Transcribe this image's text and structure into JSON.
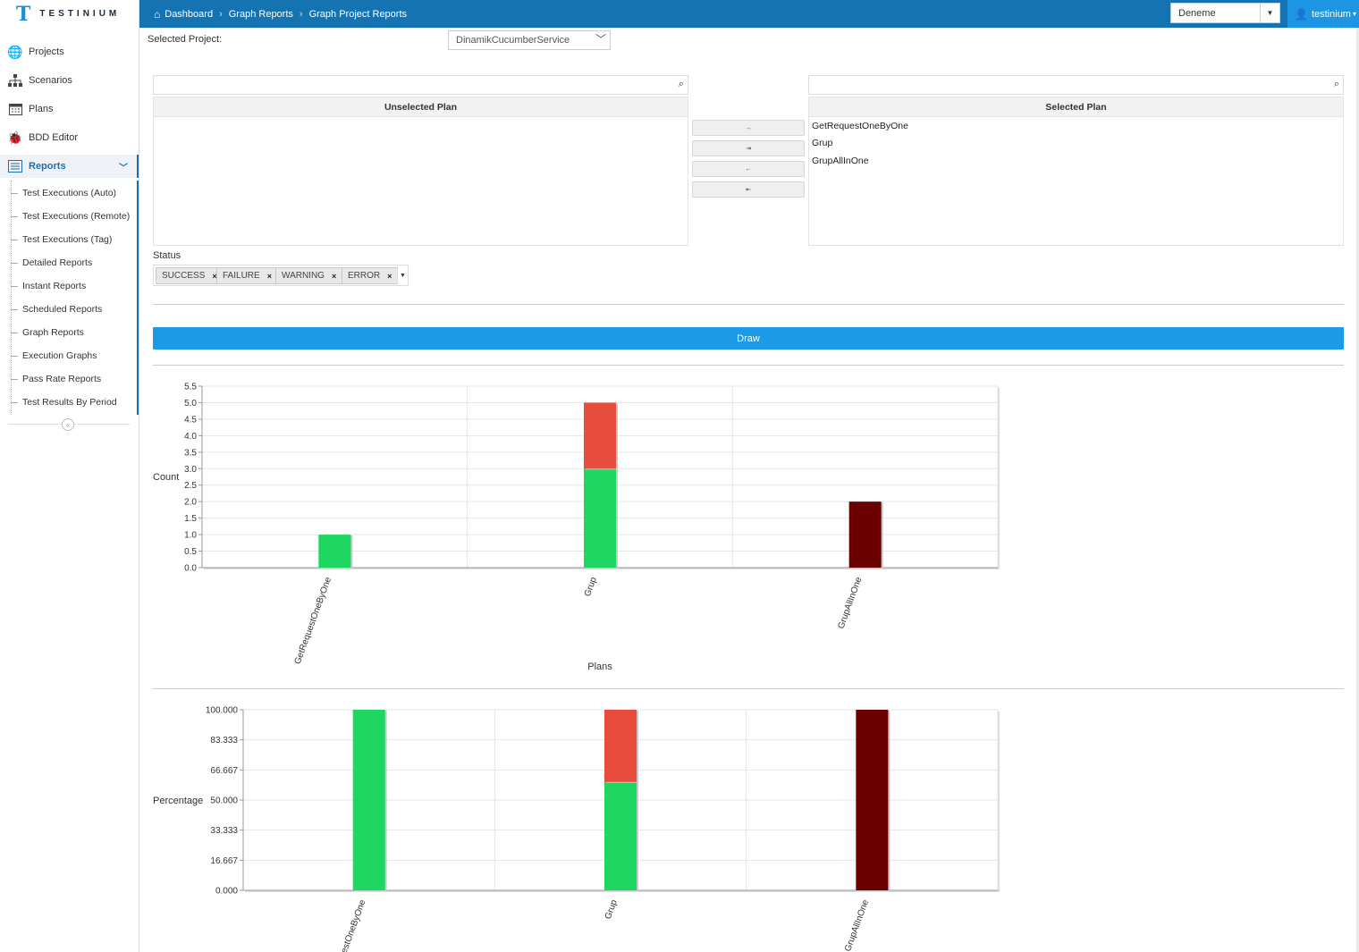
{
  "app": {
    "logo_mark": "T",
    "logo_name": "TESTINIUM"
  },
  "breadcrumb": [
    "Dashboard",
    "Graph Reports",
    "Graph Project Reports"
  ],
  "topbar": {
    "project": "Deneme",
    "user": "testinium"
  },
  "sidebar": {
    "items": [
      {
        "label": "Projects",
        "icon": "globe-icon"
      },
      {
        "label": "Scenarios",
        "icon": "sitemap-icon"
      },
      {
        "label": "Plans",
        "icon": "calendar-icon"
      },
      {
        "label": "BDD Editor",
        "icon": "bug-icon"
      },
      {
        "label": "Reports",
        "icon": "list-icon",
        "active": true
      }
    ],
    "report_items": [
      "Test Executions (Auto)",
      "Test Executions (Remote)",
      "Test Executions (Tag)",
      "Detailed Reports",
      "Instant Reports",
      "Scheduled Reports",
      "Graph Reports",
      "Execution Graphs",
      "Pass Rate Reports",
      "Test Results By Period"
    ]
  },
  "form": {
    "selected_project_label": "Selected Project:",
    "selected_project_value": "DinamikCucumberService",
    "unselected_header": "Unselected Plan",
    "selected_header": "Selected Plan",
    "selected_plans": [
      "GetRequestOneByOne",
      "Grup",
      "GrupAllInOne"
    ],
    "move_buttons": [
      "→",
      "⇥",
      "←",
      "⇤"
    ],
    "status_label": "Status",
    "status_tags": [
      "SUCCESS",
      "FAILURE",
      "WARNING",
      "ERROR"
    ],
    "draw_label": "Draw"
  },
  "colors": {
    "success": "#1ed760",
    "failure": "#e74c3c",
    "error": "#6b0000",
    "accent": "#1d9ae6"
  },
  "chart_data": [
    {
      "type": "bar",
      "categories": [
        "GetRequestOneByOne",
        "Grup",
        "GrupAllInOne"
      ],
      "series": [
        {
          "color": "#1ed760",
          "values": [
            1,
            3,
            0
          ]
        },
        {
          "color": "#e74c3c",
          "values": [
            0,
            2,
            0
          ]
        },
        {
          "color": "#6b0000",
          "values": [
            0,
            0,
            2
          ]
        }
      ],
      "ylabel": "Count",
      "xlabel": "Plans",
      "ylim": [
        0,
        5.5
      ],
      "yticks": [
        "0.0",
        "0.5",
        "1.0",
        "1.5",
        "2.0",
        "2.5",
        "3.0",
        "3.5",
        "4.0",
        "4.5",
        "5.0",
        "5.5"
      ],
      "stacked": true,
      "grid": true
    },
    {
      "type": "bar",
      "categories": [
        "GetRequestOneByOne",
        "Grup",
        "GrupAllInOne"
      ],
      "series": [
        {
          "color": "#1ed760",
          "values": [
            100,
            60,
            0
          ]
        },
        {
          "color": "#e74c3c",
          "values": [
            0,
            40,
            0
          ]
        },
        {
          "color": "#6b0000",
          "values": [
            0,
            0,
            100
          ]
        }
      ],
      "ylabel": "Percentage",
      "ylim": [
        0,
        100
      ],
      "yticks": [
        "0.000",
        "16.667",
        "33.333",
        "50.000",
        "66.667",
        "83.333",
        "100.000"
      ],
      "stacked": true,
      "grid": true
    }
  ]
}
